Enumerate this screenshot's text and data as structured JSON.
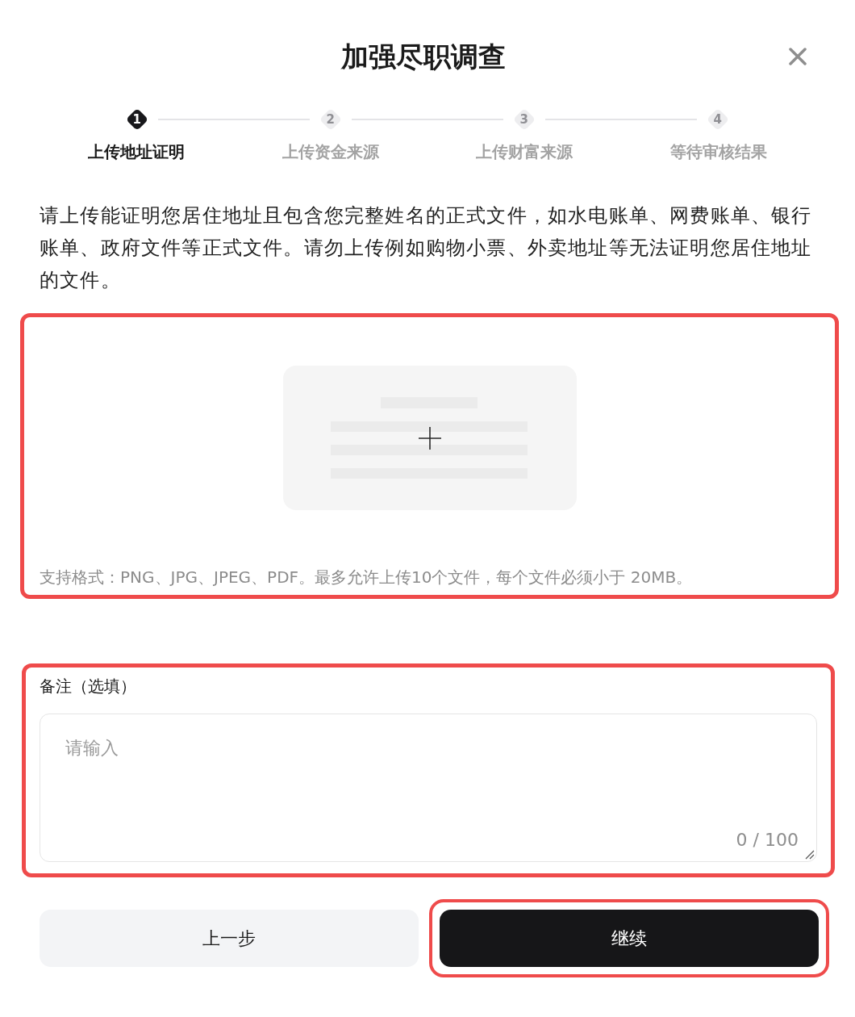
{
  "dialog": {
    "title": "加强尽职调查"
  },
  "steps": [
    {
      "number": "1",
      "label": "上传地址证明",
      "selected": true
    },
    {
      "number": "2",
      "label": "上传资金来源",
      "selected": false
    },
    {
      "number": "3",
      "label": "上传财富来源",
      "selected": false
    },
    {
      "number": "4",
      "label": "等待审核结果",
      "selected": false
    }
  ],
  "instructions": "请上传能证明您居住地址且包含您完整姓名的正式文件，如水电账单、网费账单、银行账单、政府文件等正式文件。请勿上传例如购物小票、外卖地址等无法证明您居住地址的文件。",
  "upload": {
    "highlighted": true,
    "hint": "支持格式：PNG、JPG、JPEG、PDF。最多允许上传10个文件，每个文件必须小于 20MB。"
  },
  "notes": {
    "highlighted": true,
    "label": "备注（选填）",
    "placeholder": "请输入",
    "counter": "0 / 100"
  },
  "buttons": [
    {
      "label": "上一步",
      "kind": "secondary",
      "highlighted": false
    },
    {
      "label": "继续",
      "kind": "primary",
      "highlighted": true
    }
  ]
}
